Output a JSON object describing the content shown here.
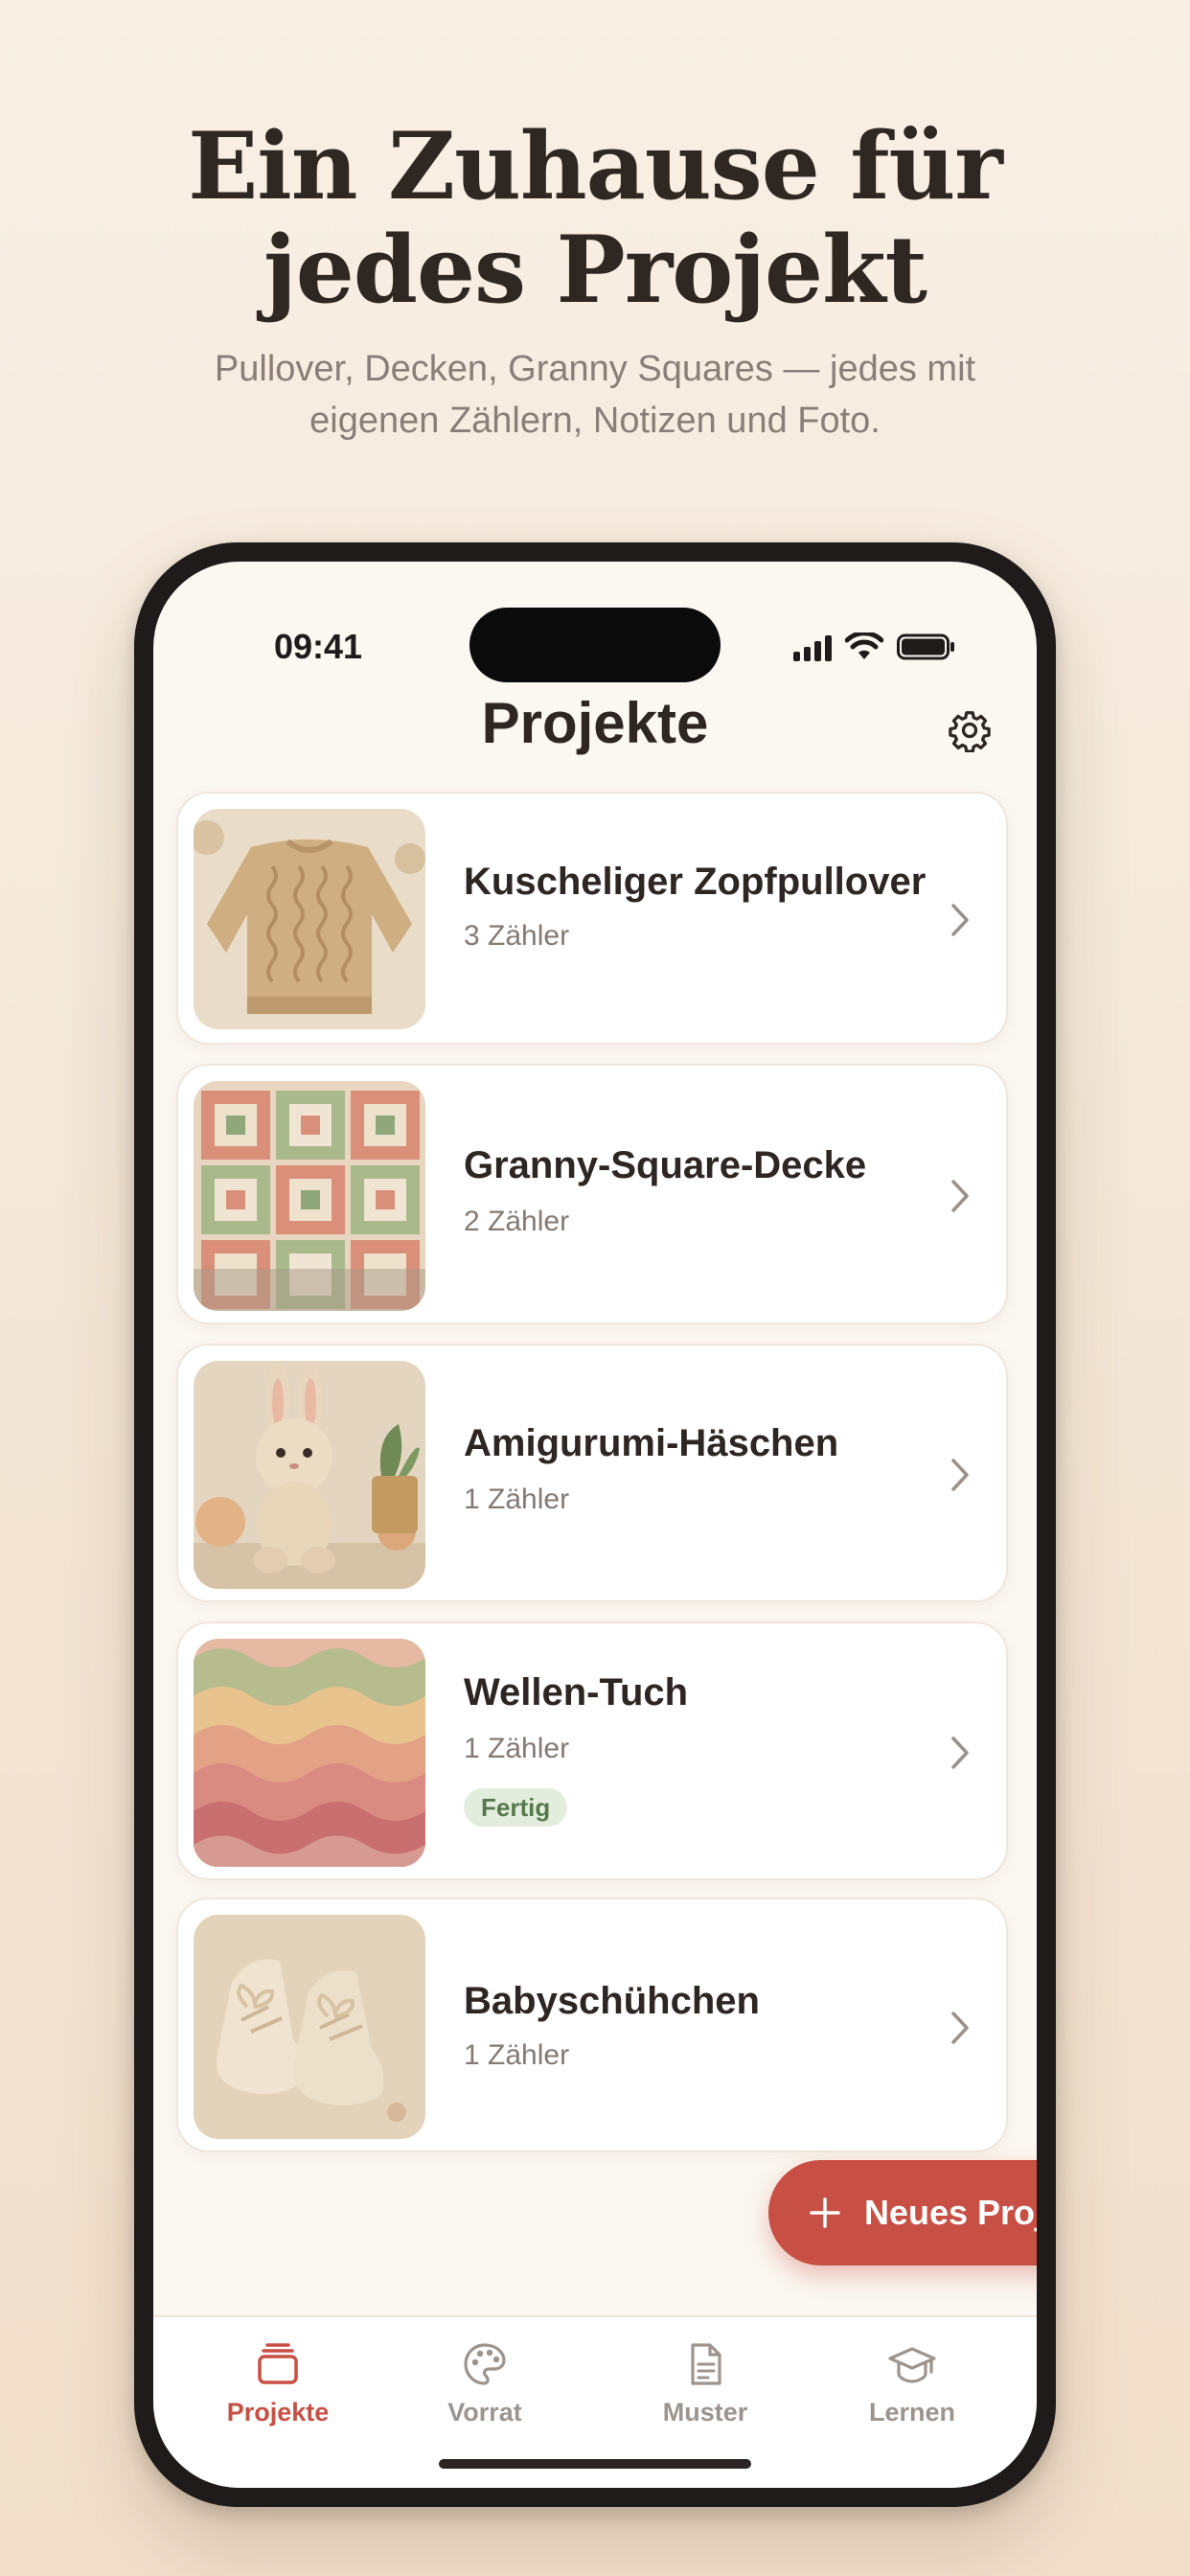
{
  "hero": {
    "title_line1": "Ein Zuhause für",
    "title_line2": "jedes Projekt",
    "subtitle_line1": "Pullover, Decken, Granny Squares — jedes mit",
    "subtitle_line2": "eigenen Zählern, Notizen und Foto."
  },
  "status_bar": {
    "time": "09:41"
  },
  "nav": {
    "title": "Projekte",
    "settings_icon": "gear-icon"
  },
  "projects": [
    {
      "title": "Kuscheliger Zopfpullover",
      "counters": "3 Zähler",
      "image": "cable-knit-sweater"
    },
    {
      "title": "Granny-Square-Decke",
      "counters": "2 Zähler",
      "image": "granny-square-blanket"
    },
    {
      "title": "Amigurumi-Häschen",
      "counters": "1 Zähler",
      "image": "amigurumi-bunny"
    },
    {
      "title": "Wellen-Tuch",
      "counters": "1 Zähler",
      "badge": "Fertig",
      "image": "wave-shawl"
    },
    {
      "title": "Babyschühchen",
      "counters": "1 Zähler",
      "image": "baby-booties"
    }
  ],
  "fab": {
    "label": "Neues Projekt",
    "icon": "plus-icon"
  },
  "tabs": [
    {
      "label": "Projekte",
      "icon": "stack-icon",
      "active": true
    },
    {
      "label": "Vorrat",
      "icon": "palette-icon",
      "active": false
    },
    {
      "label": "Muster",
      "icon": "document-icon",
      "active": false
    },
    {
      "label": "Lernen",
      "icon": "graduation-cap-icon",
      "active": false
    }
  ],
  "colors": {
    "accent": "#c84f43",
    "background": "#fbf7f1",
    "badge_bg": "#e3eddd",
    "badge_text": "#567a4c"
  }
}
